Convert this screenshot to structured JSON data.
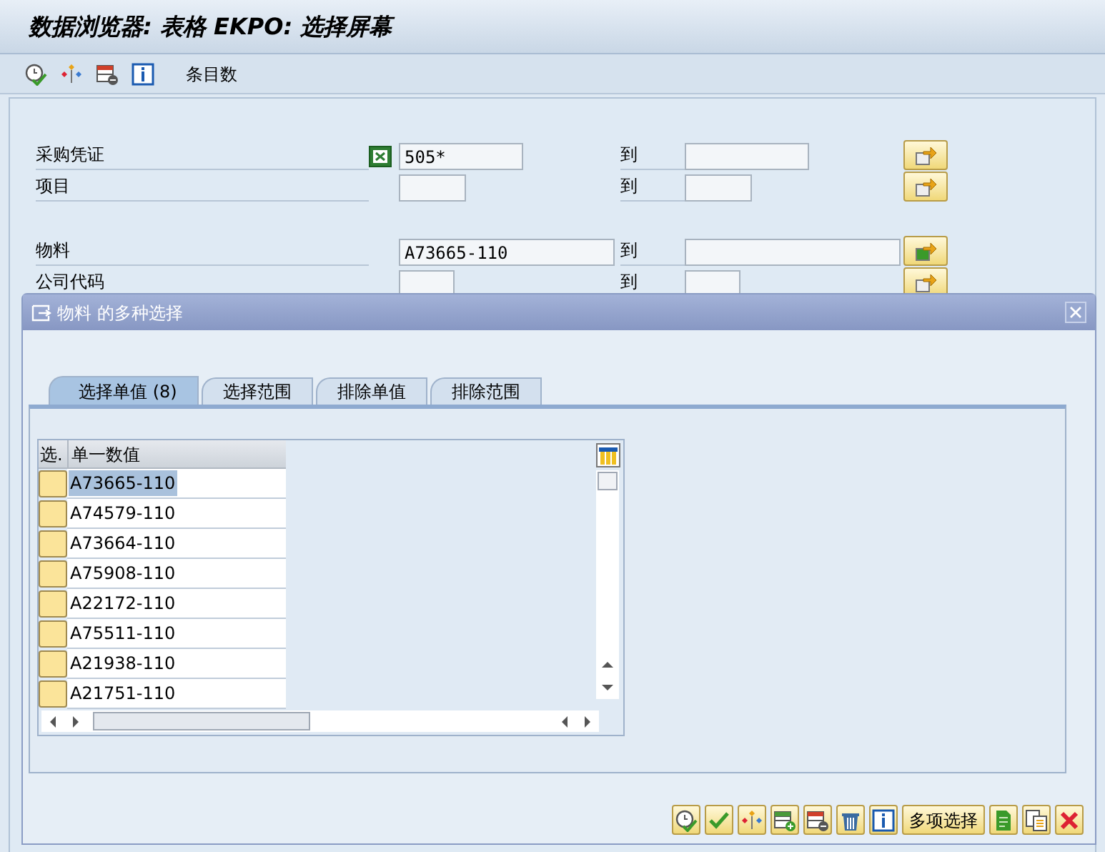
{
  "window": {
    "title": "数据浏览器: 表格 EKPO: 选择屏幕"
  },
  "toolbar": {
    "icons": [
      {
        "kind": "execute"
      },
      {
        "kind": "hierarchy"
      },
      {
        "kind": "delete-row"
      },
      {
        "kind": "info"
      }
    ],
    "label": "条目数"
  },
  "field_groups": [
    {
      "fields": [
        {
          "label": "采购凭证",
          "value": "505*",
          "to_label": "到",
          "has_selection_icon": true,
          "multi_filled": false
        },
        {
          "label": "项目",
          "to_label": "到",
          "has_selection_icon": false,
          "multi_filled": false
        }
      ]
    },
    {
      "fields": [
        {
          "label": "物料",
          "value": "A73665-110",
          "to_label": "到",
          "has_selection_icon": false,
          "multi_filled": true
        },
        {
          "label": "公司代码",
          "to_label": "到",
          "has_selection_icon": false,
          "multi_filled": false
        }
      ]
    }
  ],
  "dialog": {
    "title": "物料 的多种选择",
    "tabs": [
      {
        "label": "选择单值 (8)",
        "selected": true
      },
      {
        "label": "选择范围",
        "selected": false
      },
      {
        "label": "排除单值",
        "selected": false
      },
      {
        "label": "排除范围",
        "selected": false
      }
    ],
    "table": {
      "columns": [
        "选.",
        "单一数值"
      ],
      "rows": [
        {
          "value": "A73665-110",
          "selected": true
        },
        {
          "value": "A74579-110",
          "selected": false
        },
        {
          "value": "A73664-110",
          "selected": false
        },
        {
          "value": "A75908-110",
          "selected": false
        },
        {
          "value": "A22172-110",
          "selected": false
        },
        {
          "value": "A75511-110",
          "selected": false
        },
        {
          "value": "A21938-110",
          "selected": false
        },
        {
          "value": "A21751-110",
          "selected": false
        }
      ]
    },
    "buttons": [
      {
        "kind": "execute"
      },
      {
        "kind": "check"
      },
      {
        "kind": "hierarchy"
      },
      {
        "kind": "add-row"
      },
      {
        "kind": "delete-row"
      },
      {
        "kind": "trash"
      },
      {
        "kind": "info"
      },
      {
        "kind": "text",
        "label": "多项选择"
      },
      {
        "kind": "document"
      },
      {
        "kind": "copy"
      },
      {
        "kind": "cancel"
      }
    ]
  }
}
